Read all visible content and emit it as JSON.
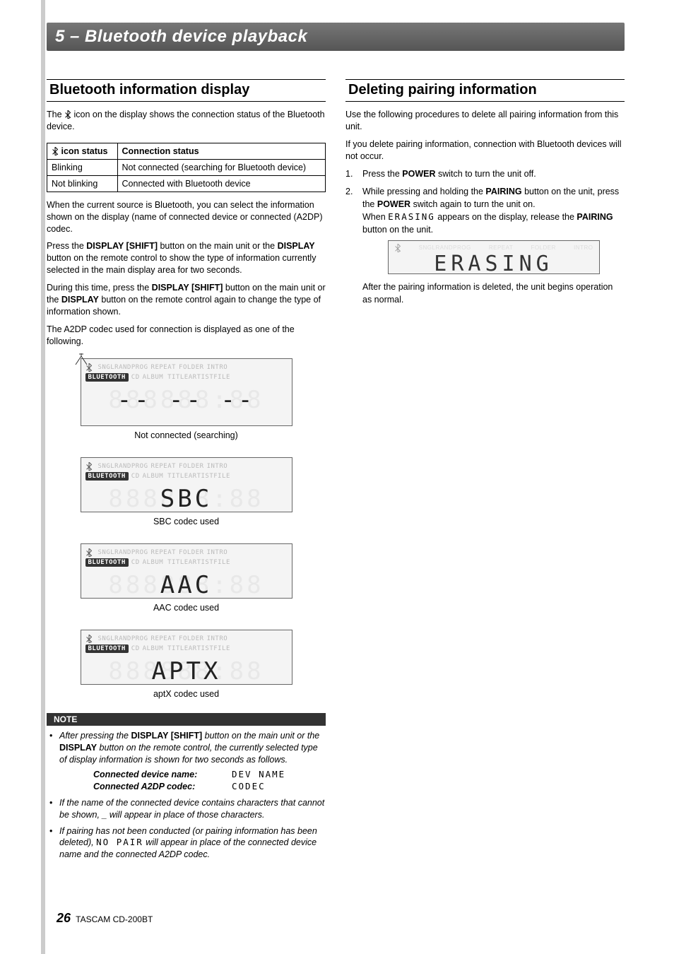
{
  "chapter_title": "5 – Bluetooth device playback",
  "left": {
    "section_title": "Bluetooth information display",
    "intro_1a": "The ",
    "intro_1b": " icon on the display shows the connection status of the Bluetooth device.",
    "table": {
      "head_icon_prefix": " icon status",
      "head_conn": "Connection status",
      "row1_status": "Blinking",
      "row1_conn": "Not connected (searching for Bluetooth device)",
      "row2_status": "Not blinking",
      "row2_conn": "Connected with Bluetooth device"
    },
    "para2": "When the current source is Bluetooth, you can select the information shown on the display (name of connected device or connected (A2DP) codec.",
    "para3_a": "Press the ",
    "para3_b": "DISPLAY [SHIFT]",
    "para3_c": " button on the main unit or the ",
    "para3_d": "DISPLAY",
    "para3_e": " button on the remote control to show the type of information currently selected in the main display area for two seconds.",
    "para4_a": "During this time, press the ",
    "para4_b": "DISPLAY [SHIFT]",
    "para4_c": " button on the main unit or the ",
    "para4_d": "DISPLAY",
    "para4_e": " button on the remote control again to change the type of information shown.",
    "para5": "The A2DP codec used for connection is displayed as one of the following.",
    "caption1": "Not connected (searching)",
    "caption2": "SBC codec used",
    "caption3": "AAC codec used",
    "caption4": "aptX codec used",
    "lcd": {
      "badge": "BLUETOOTH",
      "ghost1": "SNGLRANDPROG",
      "ghost2": "REPEAT",
      "ghost3": "FOLDER",
      "ghost4": "INTRO",
      "ghost5": "CD",
      "ghost6": "ALBUM TITLEARTISTFILE",
      "segghost": "888888:88",
      "dashes": "-- -- --",
      "seg_sbc": "SBC",
      "seg_aac": "AAC",
      "seg_aptx": "APTX"
    },
    "note_label": "NOTE",
    "note1_a": "After pressing the ",
    "note1_b": "DISPLAY [SHIFT]",
    "note1_c": " button on the main unit or the ",
    "note1_d": "DISPLAY",
    "note1_e": " button on the remote control, the currently selected type of display information is shown for two seconds as follows.",
    "kv1_k": "Connected device name:",
    "kv1_v": "DEV NAME",
    "kv2_k": "Connected A2DP codec:",
    "kv2_v": "CODEC",
    "note2": "If the name of the connected device contains characters that cannot be shown, _ will appear in place of those characters.",
    "note3_a": "If pairing has not been conducted (or pairing information has been deleted), ",
    "note3_b": "NO PAIR",
    "note3_c": " will appear in place of the connected device name and the connected A2DP codec."
  },
  "right": {
    "section_title": "Deleting pairing information",
    "para1": "Use the following procedures to delete all pairing information from this unit.",
    "para2": "If you delete pairing information, connection with Bluetooth devices will not occur.",
    "step1_a": "Press the ",
    "step1_b": "POWER",
    "step1_c": " switch to turn the unit off.",
    "step2_a": "While pressing and holding the ",
    "step2_b": "PAIRING",
    "step2_c": " button on the unit, press the ",
    "step2_d": "POWER",
    "step2_e": " switch again to turn the unit on.",
    "step2_f": "When ",
    "step2_g": "ERASING",
    "step2_h": " appears on the display, release the ",
    "step2_i": "PAIRING",
    "step2_j": " button on the unit.",
    "erasing_lcd": "ERASING",
    "after": "After the pairing information is deleted, the unit begins operation as normal."
  },
  "footer": {
    "page": "26",
    "model": "TASCAM  CD-200BT"
  }
}
